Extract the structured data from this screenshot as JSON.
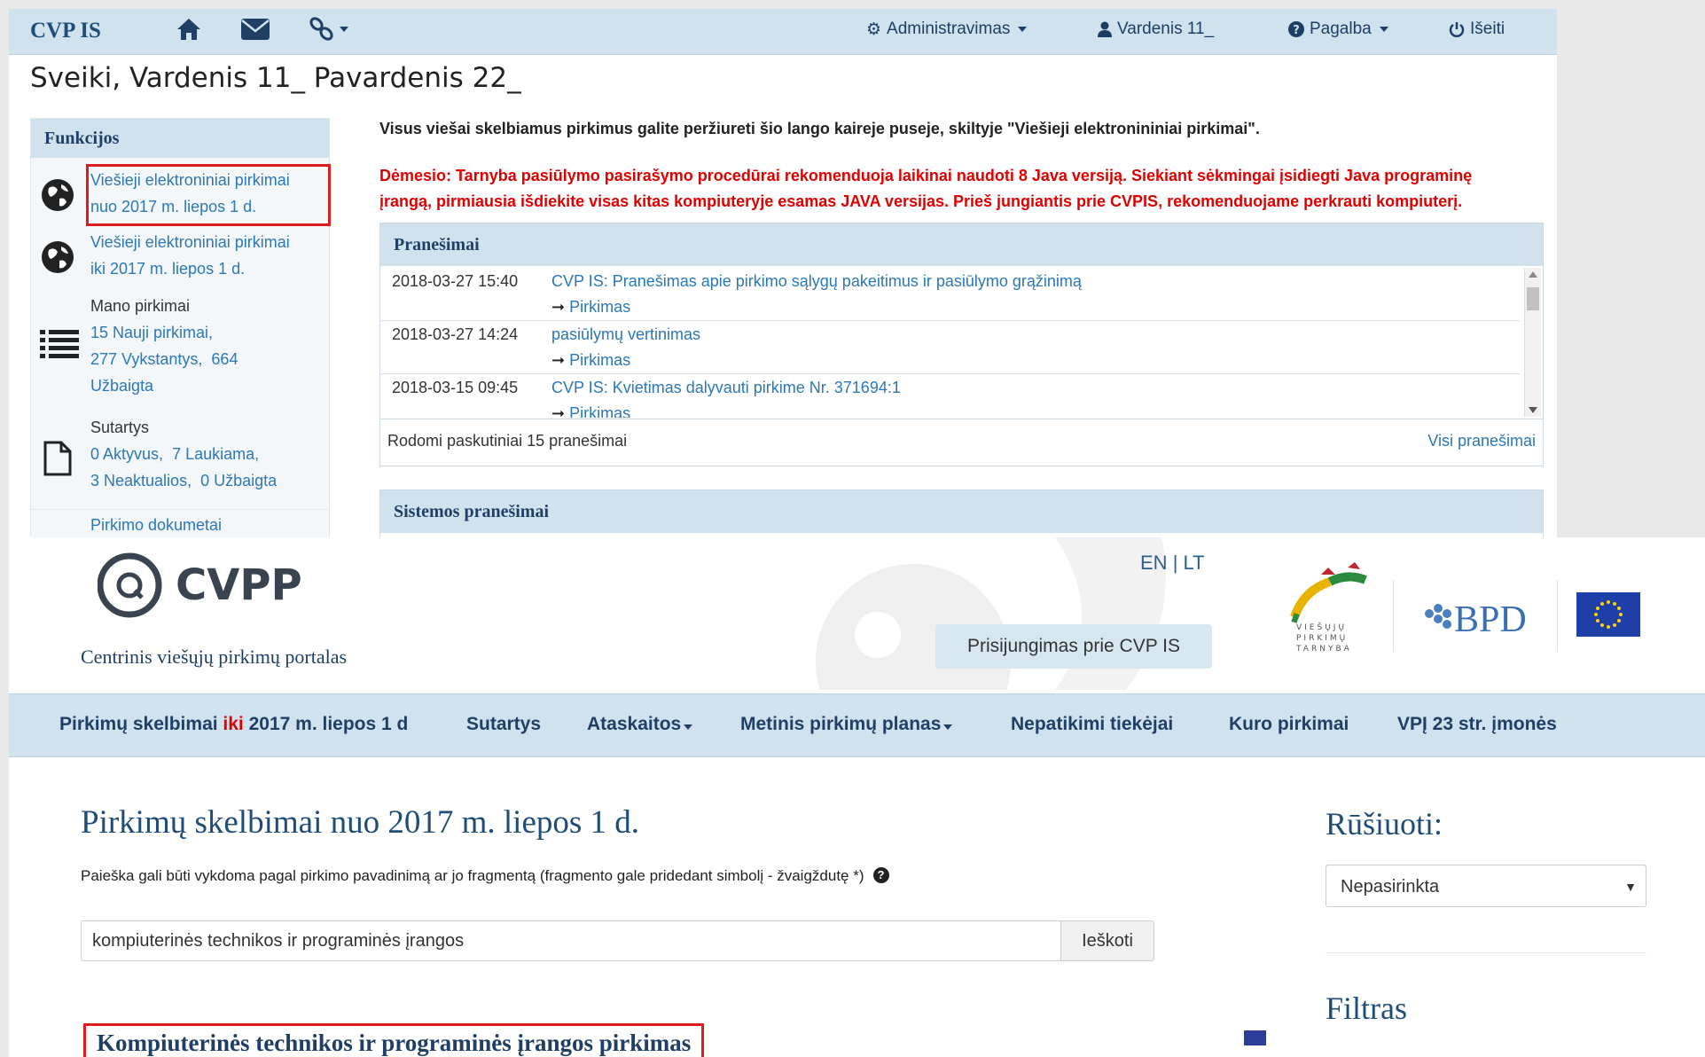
{
  "top_app": {
    "brand": "CVP IS",
    "nav_icons": [
      "home-icon",
      "envelope-icon",
      "link-icon"
    ],
    "menu": {
      "admin": "Administravimas",
      "user": "Vardenis 11_",
      "help": "Pagalba",
      "logout": "Išeiti"
    },
    "greeting": "Sveiki, Vardenis 11_ Pavardenis 22_",
    "functions": {
      "title": "Funkcijos",
      "items": [
        {
          "icon": "globe-icon",
          "line1": "Viešieji elektroniniai pirkimai",
          "line2": "nuo 2017 m. liepos 1 d."
        },
        {
          "icon": "globe-icon",
          "line1": "Viešieji elektroniniai pirkimai",
          "line2": "iki 2017 m. liepos 1 d."
        },
        {
          "icon": "list-icon",
          "label": "Mano pirkimai",
          "l1": "15 Nauji pirkimai,",
          "l2a": "277 Vykstantys,",
          "l2b": "664",
          "l3": "Užbaigta"
        },
        {
          "icon": "document-icon",
          "label": "Sutartys",
          "l1a": "0 Aktyvus,",
          "l1b": "7 Laukiama,",
          "l2a": "3 Neaktualios,",
          "l2b": "0 Užbaigta"
        },
        {
          "icon": "document-icon",
          "line1": "Pirkimo dokumetai"
        }
      ]
    },
    "notice": "Visus viešai skelbiamus pirkimus galite peržiureti šio lango kaireje puseje, skiltyje \"Viešieji elektronininiai pirkimai\".",
    "warning_line1": "Dėmesio: Tarnyba pasiūlymo pasirašymo procedūrai rekomenduoja laikinai naudoti 8 Java versiją. Siekiant sėkmingai įsidiegti Java programinę",
    "warning_line2": "įrangą, pirmiausia išdiekite visas kitas kompiuteryje esamas JAVA versijas. Prieš jungiantis prie CVPIS, rekomenduojame perkrauti kompiuterį.",
    "messages": {
      "title": "Pranešimai",
      "rows": [
        {
          "date": "2018-03-27 15:40",
          "title": "CVP IS: Pranešimas apie pirkimo sąlygų pakeitimus ir pasiūlymo grąžinimą",
          "link": "Pirkimas"
        },
        {
          "date": "2018-03-27 14:24",
          "title": "pasiūlymų vertinimas",
          "link": "Pirkimas"
        },
        {
          "date": "2018-03-15 09:45",
          "title": "CVP IS: Kvietimas dalyvauti pirkime Nr. 371694:1",
          "link": "Pirkimas"
        }
      ],
      "footer_left": "Rodomi paskutiniai 15 pranešimai",
      "footer_right": "Visi pranešimai"
    },
    "system_messages_title": "Sistemos pranešimai"
  },
  "portal": {
    "logo_text": "CVPP",
    "portal_name": "Centrinis viešųjų pirkimų portalas",
    "lang_en": "EN",
    "lang_sep": "|",
    "lang_lt": "LT",
    "login_button": "Prisijungimas prie CVP IS",
    "vpt_logo_text": [
      "VIEŠŲJŲ",
      "PIRKIMŲ",
      "TARNYBA"
    ],
    "bpd_logo_text": "BPD",
    "nav": {
      "item1_pre": "Pirkimų skelbimai ",
      "item1_hl": "iki",
      "item1_post": " 2017 m. liepos 1 d",
      "item2": "Sutartys",
      "item3": "Ataskaitos",
      "item4": "Metinis pirkimų planas",
      "item5": "Nepatikimi tiekėjai",
      "item6": "Kuro pirkimai",
      "item7": "VPĮ 23 str. įmonės"
    },
    "page_title": "Pirkimų skelbimai nuo 2017 m. liepos 1 d.",
    "search_hint": "Paieška gali būti vykdoma pagal pirkimo pavadinimą ar jo fragmentą (fragmento gale pridedant simbolį - žvaigždutę *)",
    "search_value": "kompiuterinės technikos ir programinės įrangos",
    "search_button": "Ieškoti",
    "sort_title": "Rūšiuoti:",
    "sort_selected": "Nepasirinkta",
    "filter_title": "Filtras",
    "result_title": "Kompiuterinės technikos ir programinės įrangos pirkimas"
  },
  "colors": {
    "accent": "#cfe2ee",
    "link": "#2a78b8",
    "warning": "#e00000",
    "highlight_box": "#e01b1b"
  }
}
